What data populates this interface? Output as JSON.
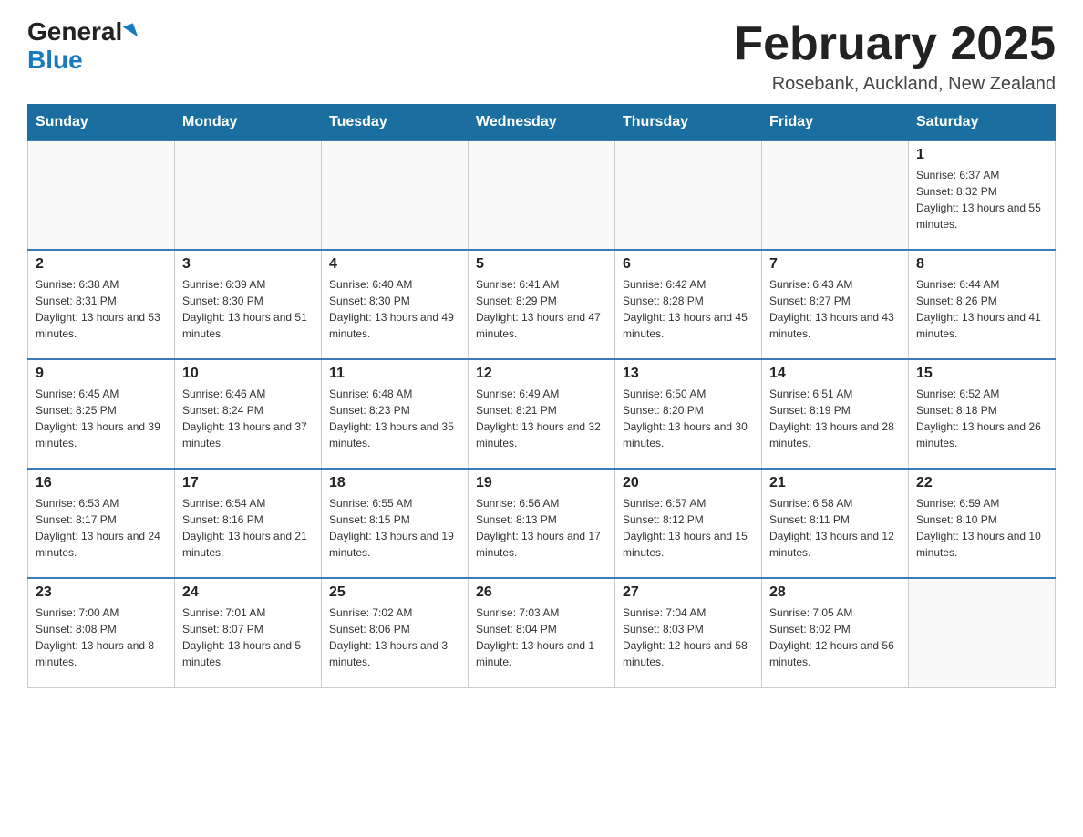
{
  "header": {
    "logo_general": "General",
    "logo_blue": "Blue",
    "month_title": "February 2025",
    "location": "Rosebank, Auckland, New Zealand"
  },
  "days_of_week": [
    "Sunday",
    "Monday",
    "Tuesday",
    "Wednesday",
    "Thursday",
    "Friday",
    "Saturday"
  ],
  "weeks": [
    [
      {
        "day": "",
        "info": ""
      },
      {
        "day": "",
        "info": ""
      },
      {
        "day": "",
        "info": ""
      },
      {
        "day": "",
        "info": ""
      },
      {
        "day": "",
        "info": ""
      },
      {
        "day": "",
        "info": ""
      },
      {
        "day": "1",
        "info": "Sunrise: 6:37 AM\nSunset: 8:32 PM\nDaylight: 13 hours and 55 minutes."
      }
    ],
    [
      {
        "day": "2",
        "info": "Sunrise: 6:38 AM\nSunset: 8:31 PM\nDaylight: 13 hours and 53 minutes."
      },
      {
        "day": "3",
        "info": "Sunrise: 6:39 AM\nSunset: 8:30 PM\nDaylight: 13 hours and 51 minutes."
      },
      {
        "day": "4",
        "info": "Sunrise: 6:40 AM\nSunset: 8:30 PM\nDaylight: 13 hours and 49 minutes."
      },
      {
        "day": "5",
        "info": "Sunrise: 6:41 AM\nSunset: 8:29 PM\nDaylight: 13 hours and 47 minutes."
      },
      {
        "day": "6",
        "info": "Sunrise: 6:42 AM\nSunset: 8:28 PM\nDaylight: 13 hours and 45 minutes."
      },
      {
        "day": "7",
        "info": "Sunrise: 6:43 AM\nSunset: 8:27 PM\nDaylight: 13 hours and 43 minutes."
      },
      {
        "day": "8",
        "info": "Sunrise: 6:44 AM\nSunset: 8:26 PM\nDaylight: 13 hours and 41 minutes."
      }
    ],
    [
      {
        "day": "9",
        "info": "Sunrise: 6:45 AM\nSunset: 8:25 PM\nDaylight: 13 hours and 39 minutes."
      },
      {
        "day": "10",
        "info": "Sunrise: 6:46 AM\nSunset: 8:24 PM\nDaylight: 13 hours and 37 minutes."
      },
      {
        "day": "11",
        "info": "Sunrise: 6:48 AM\nSunset: 8:23 PM\nDaylight: 13 hours and 35 minutes."
      },
      {
        "day": "12",
        "info": "Sunrise: 6:49 AM\nSunset: 8:21 PM\nDaylight: 13 hours and 32 minutes."
      },
      {
        "day": "13",
        "info": "Sunrise: 6:50 AM\nSunset: 8:20 PM\nDaylight: 13 hours and 30 minutes."
      },
      {
        "day": "14",
        "info": "Sunrise: 6:51 AM\nSunset: 8:19 PM\nDaylight: 13 hours and 28 minutes."
      },
      {
        "day": "15",
        "info": "Sunrise: 6:52 AM\nSunset: 8:18 PM\nDaylight: 13 hours and 26 minutes."
      }
    ],
    [
      {
        "day": "16",
        "info": "Sunrise: 6:53 AM\nSunset: 8:17 PM\nDaylight: 13 hours and 24 minutes."
      },
      {
        "day": "17",
        "info": "Sunrise: 6:54 AM\nSunset: 8:16 PM\nDaylight: 13 hours and 21 minutes."
      },
      {
        "day": "18",
        "info": "Sunrise: 6:55 AM\nSunset: 8:15 PM\nDaylight: 13 hours and 19 minutes."
      },
      {
        "day": "19",
        "info": "Sunrise: 6:56 AM\nSunset: 8:13 PM\nDaylight: 13 hours and 17 minutes."
      },
      {
        "day": "20",
        "info": "Sunrise: 6:57 AM\nSunset: 8:12 PM\nDaylight: 13 hours and 15 minutes."
      },
      {
        "day": "21",
        "info": "Sunrise: 6:58 AM\nSunset: 8:11 PM\nDaylight: 13 hours and 12 minutes."
      },
      {
        "day": "22",
        "info": "Sunrise: 6:59 AM\nSunset: 8:10 PM\nDaylight: 13 hours and 10 minutes."
      }
    ],
    [
      {
        "day": "23",
        "info": "Sunrise: 7:00 AM\nSunset: 8:08 PM\nDaylight: 13 hours and 8 minutes."
      },
      {
        "day": "24",
        "info": "Sunrise: 7:01 AM\nSunset: 8:07 PM\nDaylight: 13 hours and 5 minutes."
      },
      {
        "day": "25",
        "info": "Sunrise: 7:02 AM\nSunset: 8:06 PM\nDaylight: 13 hours and 3 minutes."
      },
      {
        "day": "26",
        "info": "Sunrise: 7:03 AM\nSunset: 8:04 PM\nDaylight: 13 hours and 1 minute."
      },
      {
        "day": "27",
        "info": "Sunrise: 7:04 AM\nSunset: 8:03 PM\nDaylight: 12 hours and 58 minutes."
      },
      {
        "day": "28",
        "info": "Sunrise: 7:05 AM\nSunset: 8:02 PM\nDaylight: 12 hours and 56 minutes."
      },
      {
        "day": "",
        "info": ""
      }
    ]
  ]
}
